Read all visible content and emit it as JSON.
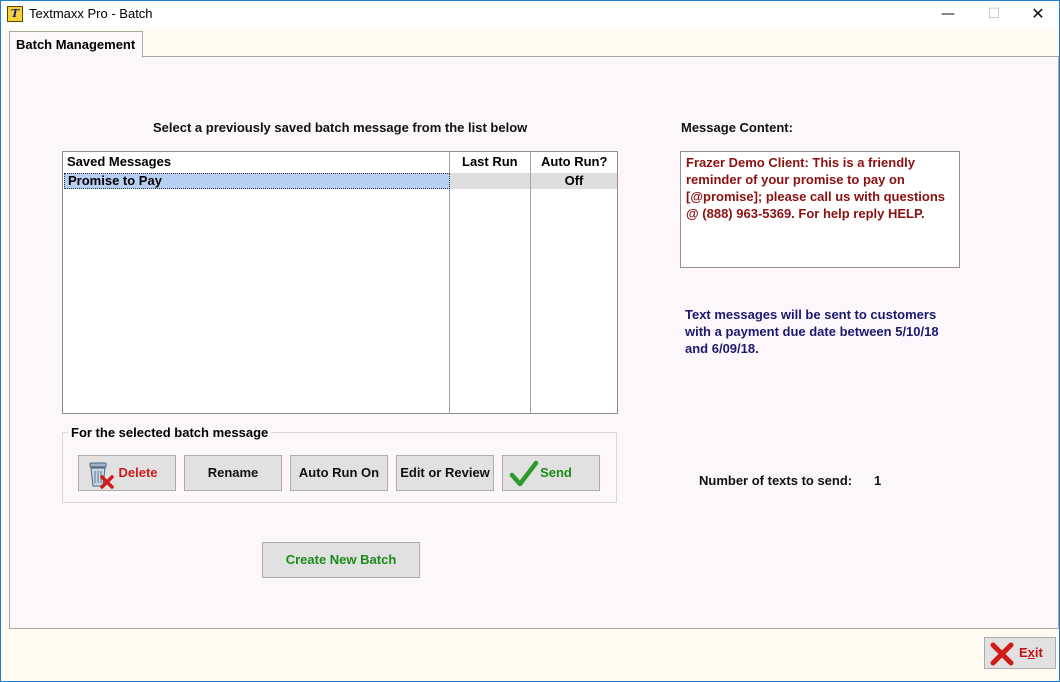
{
  "window": {
    "title": "Textmaxx Pro - Batch",
    "app_icon": "textmaxx-logo-icon",
    "controls": {
      "minimize": "—",
      "maximize": "☐",
      "close": "✕"
    }
  },
  "tabs": [
    {
      "label": "Batch Management",
      "active": true
    }
  ],
  "instructions": "Select a previously saved batch message from the list below",
  "grid": {
    "columns": [
      "Saved Messages",
      "Last Run",
      "Auto Run?"
    ],
    "rows": [
      {
        "name": "Promise to Pay",
        "last_run": "",
        "auto_run": "Off",
        "selected": true
      }
    ]
  },
  "batch_actions": {
    "group_title": "For the selected batch message",
    "delete": "Delete",
    "rename": "Rename",
    "auto_run_on": "Auto Run On",
    "edit_or_review": "Edit or Review",
    "send": "Send"
  },
  "create_new_batch": "Create New Batch",
  "message_content": {
    "label": "Message Content:",
    "text": "Frazer Demo Client: This is a friendly\nreminder of your promise to pay on\n[@promise]; please call us with questions\n@ (888) 963-5369. For help reply HELP."
  },
  "send_info": "Text messages will be sent to customers\nwith a payment due date between 5/10/18\nand 6/09/18.",
  "texts_to_send": {
    "label": "Number of texts to send:",
    "count": "1"
  },
  "exit": {
    "label": "Exit",
    "underline": "x"
  },
  "colors": {
    "delete": "#d11b1b",
    "send": "#1b8a1b",
    "message_text": "#8b1010",
    "info_text": "#1a1a6e",
    "selected_row": "#b8cff4"
  }
}
